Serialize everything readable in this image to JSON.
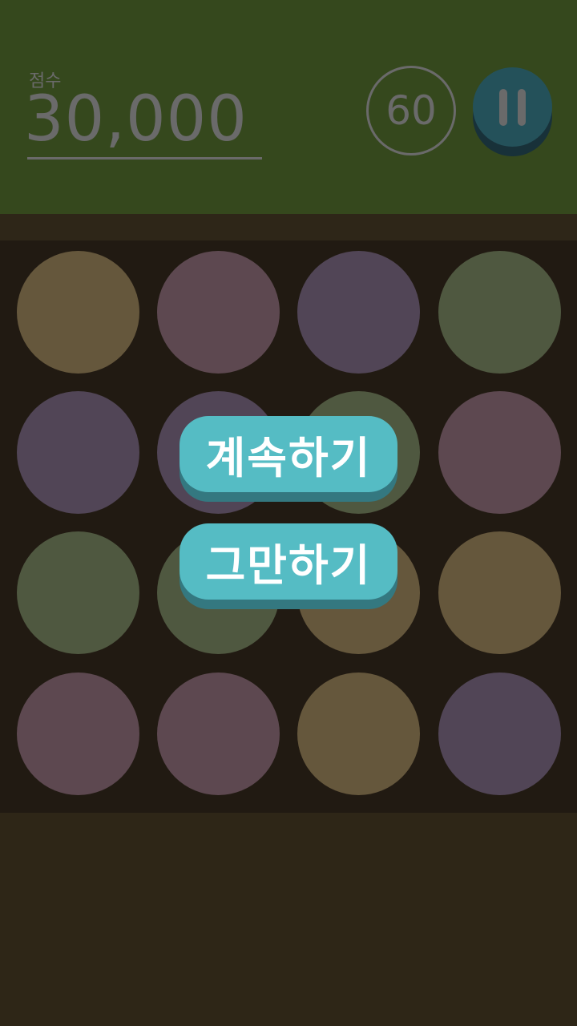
{
  "header": {
    "score_label": "점수",
    "score_value": "30,000",
    "timer_value": "60"
  },
  "colors": {
    "header_bg": "#35481d",
    "board_bg": "#211a12",
    "page_bg": "#2e2617",
    "button_face": "#55bcc4",
    "button_shadow": "#347880",
    "pause_face": "#24515a",
    "text_dim": "#6a6a6a"
  },
  "board": {
    "rows": [
      [
        "tan",
        "mauve",
        "purple",
        "green"
      ],
      [
        "purple",
        "purple",
        "green",
        "mauve"
      ],
      [
        "green",
        "green",
        "tan",
        "tan"
      ],
      [
        "mauve",
        "mauve",
        "tan",
        "purple"
      ]
    ]
  },
  "pause_menu": {
    "continue_label": "계속하기",
    "quit_label": "그만하기"
  }
}
